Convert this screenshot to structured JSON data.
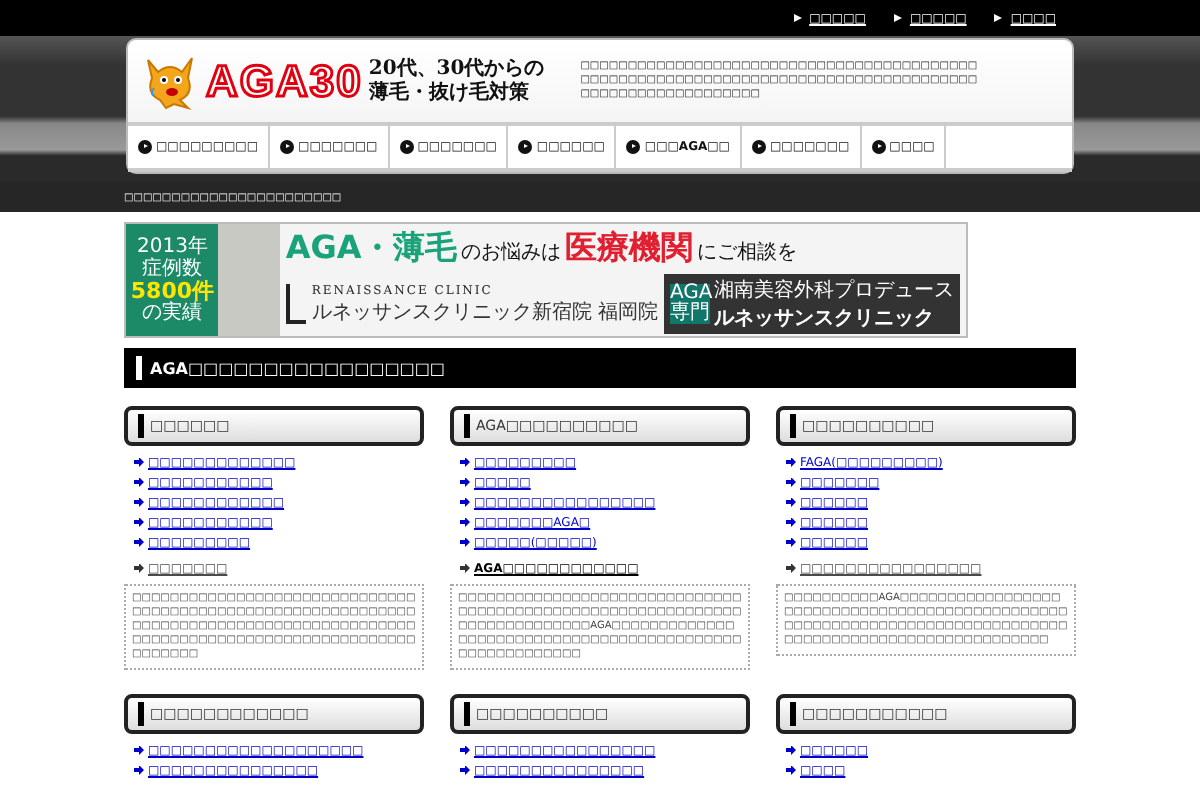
{
  "top_links": [
    {
      "label": "□□□□□"
    },
    {
      "label": "□□□□□"
    },
    {
      "label": "□□□□"
    }
  ],
  "logo": {
    "wordmark": "AGA30",
    "tagline": [
      "20代、30代からの",
      "薄毛・抜け毛対策"
    ]
  },
  "header_description": "□□□□□□□□□□□□□□□□□□□□□□□□□□□□□□□□□□□□□□□□□□□□□□□□□□□□□□□□□□□□□□□□□□□□□□□□□□□□□□□□□□□□□□□□□□□□□□□□□□□□□□□",
  "nav": [
    {
      "label": "□□□□□□□□□"
    },
    {
      "label": "□□□□□□□"
    },
    {
      "label": "□□□□□□□"
    },
    {
      "label": "□□□□□□"
    },
    {
      "label": "□□□AGA□□"
    },
    {
      "label": "□□□□□□□"
    },
    {
      "label": "□□□□"
    }
  ],
  "breadcrumb": "□□□□□□□□□□□□□□□□□□□□□□□",
  "banner": {
    "year": "2013年",
    "cases_label": "症例数",
    "cases": "5800件",
    "cases_suffix": "の実績",
    "headline": "AGA・薄毛",
    "headline_2": "のお悩みは",
    "headline_3": "医療機関",
    "headline_4": "にご相談を",
    "clinic_en": "RENAISSANCE CLINIC",
    "clinic_branches": "ルネッサンスクリニック新宿院 福岡院",
    "badge": "AGA専門",
    "producer": "湘南美容外科プロデュース",
    "clinic_name": "ルネッサンスクリニック"
  },
  "main_heading": "AGA□□□□□□□□□□□□□□□□□",
  "sections": [
    {
      "title": "□□□□□□",
      "links": [
        "□□□□□□□□□□□□□",
        "□□□□□□□□□□□",
        "□□□□□□□□□□□□",
        "□□□□□□□□□□□",
        "□□□□□□□□□"
      ],
      "subheading": "□□□□□□□",
      "bold": false,
      "text": "□□□□□□□□□□□□□□□□□□□□□□□□□□□□□□□□□□□□□□□□□□□□□□□□□□□□□□□□□□□□□□□□□□□□□□□□□□□□□□□□□□□□□□□□□□□□□□□□□□□□□□□□□□□□□□□□□□□□□□□□□□□□□□□"
    },
    {
      "title": "AGA□□□□□□□□□□",
      "links": [
        "□□□□□□□□□",
        "□□□□□",
        "□□□□□□□□□□□□□□□□",
        "□□□□□□□AGA□",
        "□□□□□(□□□□□)"
      ],
      "subheading": "AGA□□□□□□□□□□□□",
      "bold": true,
      "text": "□□□□□□□□□□□□□□□□□□□□□□□□□□□□□□□□□□□□□□□□□□□□□□□□□□□□□□□□□□□□□□□□□□□□□□□□□□AGA□□□□□□□□□□□□□□□□□□□□□□□□□□□□□□□□□□□□□□□□□□□□□□□□□□□□□□□□"
    },
    {
      "title": "□□□□□□□□□□",
      "links": [
        "FAGA(□□□□□□□□□)",
        "□□□□□□□",
        "□□□□□□",
        "□□□□□□",
        "□□□□□□"
      ],
      "subheading": "□□□□□□□□□□□□□□□□",
      "bold": false,
      "text": "□□□□□□□□□□AGA□□□□□□□□□□□□□□□□□□□□□□□□□□□□□□□□□□□□□□□□□□□□□□□□□□□□□□□□□□□□□□□□□□□□□□□□□□□□□□□□□□□□□□□□□□□□□□□□□□□□□□□□□"
    },
    {
      "title": "□□□□□□□□□□□□",
      "links": [
        "□□□□□□□□□□□□□□□□□□□",
        "□□□□□□□□□□□□□□□"
      ]
    },
    {
      "title": "□□□□□□□□□□",
      "links": [
        "□□□□□□□□□□□□□□□□",
        "□□□□□□□□□□□□□□□"
      ]
    },
    {
      "title": "□□□□□□□□□□□",
      "links": [
        "□□□□□□",
        "□□□□"
      ]
    }
  ]
}
